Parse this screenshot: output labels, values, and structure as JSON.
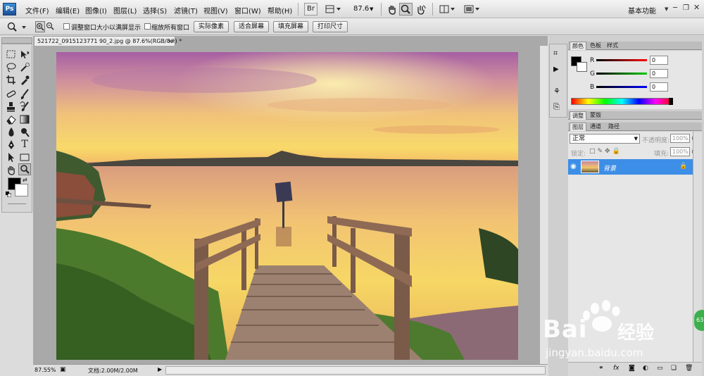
{
  "app": {
    "logo": "Ps"
  },
  "menu": [
    "文件(F)",
    "编辑(E)",
    "图像(I)",
    "图层(L)",
    "选择(S)",
    "滤镜(T)",
    "视图(V)",
    "窗口(W)",
    "帮助(H)"
  ],
  "menubar": {
    "bridge": "Br",
    "zoom": "87.6",
    "workspace": "基本功能"
  },
  "options": {
    "check_resize": "调整窗口大小以满屏显示",
    "check_all": "缩放所有窗口",
    "btn_actual": "实际像素",
    "btn_fit": "适合屏幕",
    "btn_fill": "填充屏幕",
    "btn_print": "打印尺寸"
  },
  "document": {
    "tab_title": "521722_0915123771 90_2.jpg @ 87.6%(RGB/8#) *",
    "close": "×"
  },
  "status": {
    "zoom": "87.55%",
    "doc_info": "文档:2.00M/2.00M"
  },
  "color_panel": {
    "tabs": [
      "颜色",
      "色板",
      "样式"
    ],
    "r_label": "R",
    "g_label": "G",
    "b_label": "B",
    "r": "0",
    "g": "0",
    "b": "0"
  },
  "adjust_panel": {
    "tabs": [
      "调整",
      "蒙版"
    ]
  },
  "layers_panel": {
    "tabs": [
      "图层",
      "通道",
      "路径"
    ],
    "blend_mode": "正常",
    "opacity_label": "不透明度:",
    "opacity": "100%",
    "lock_label": "锁定:",
    "fill_label": "填充:",
    "fill": "100%",
    "layer_name": "背景"
  },
  "watermark": {
    "brand": "Bai",
    "brand2": "经验",
    "url": "jingyan.baidu.com",
    "badge": "63"
  },
  "colors": {
    "accent": "#3d8ee6"
  }
}
